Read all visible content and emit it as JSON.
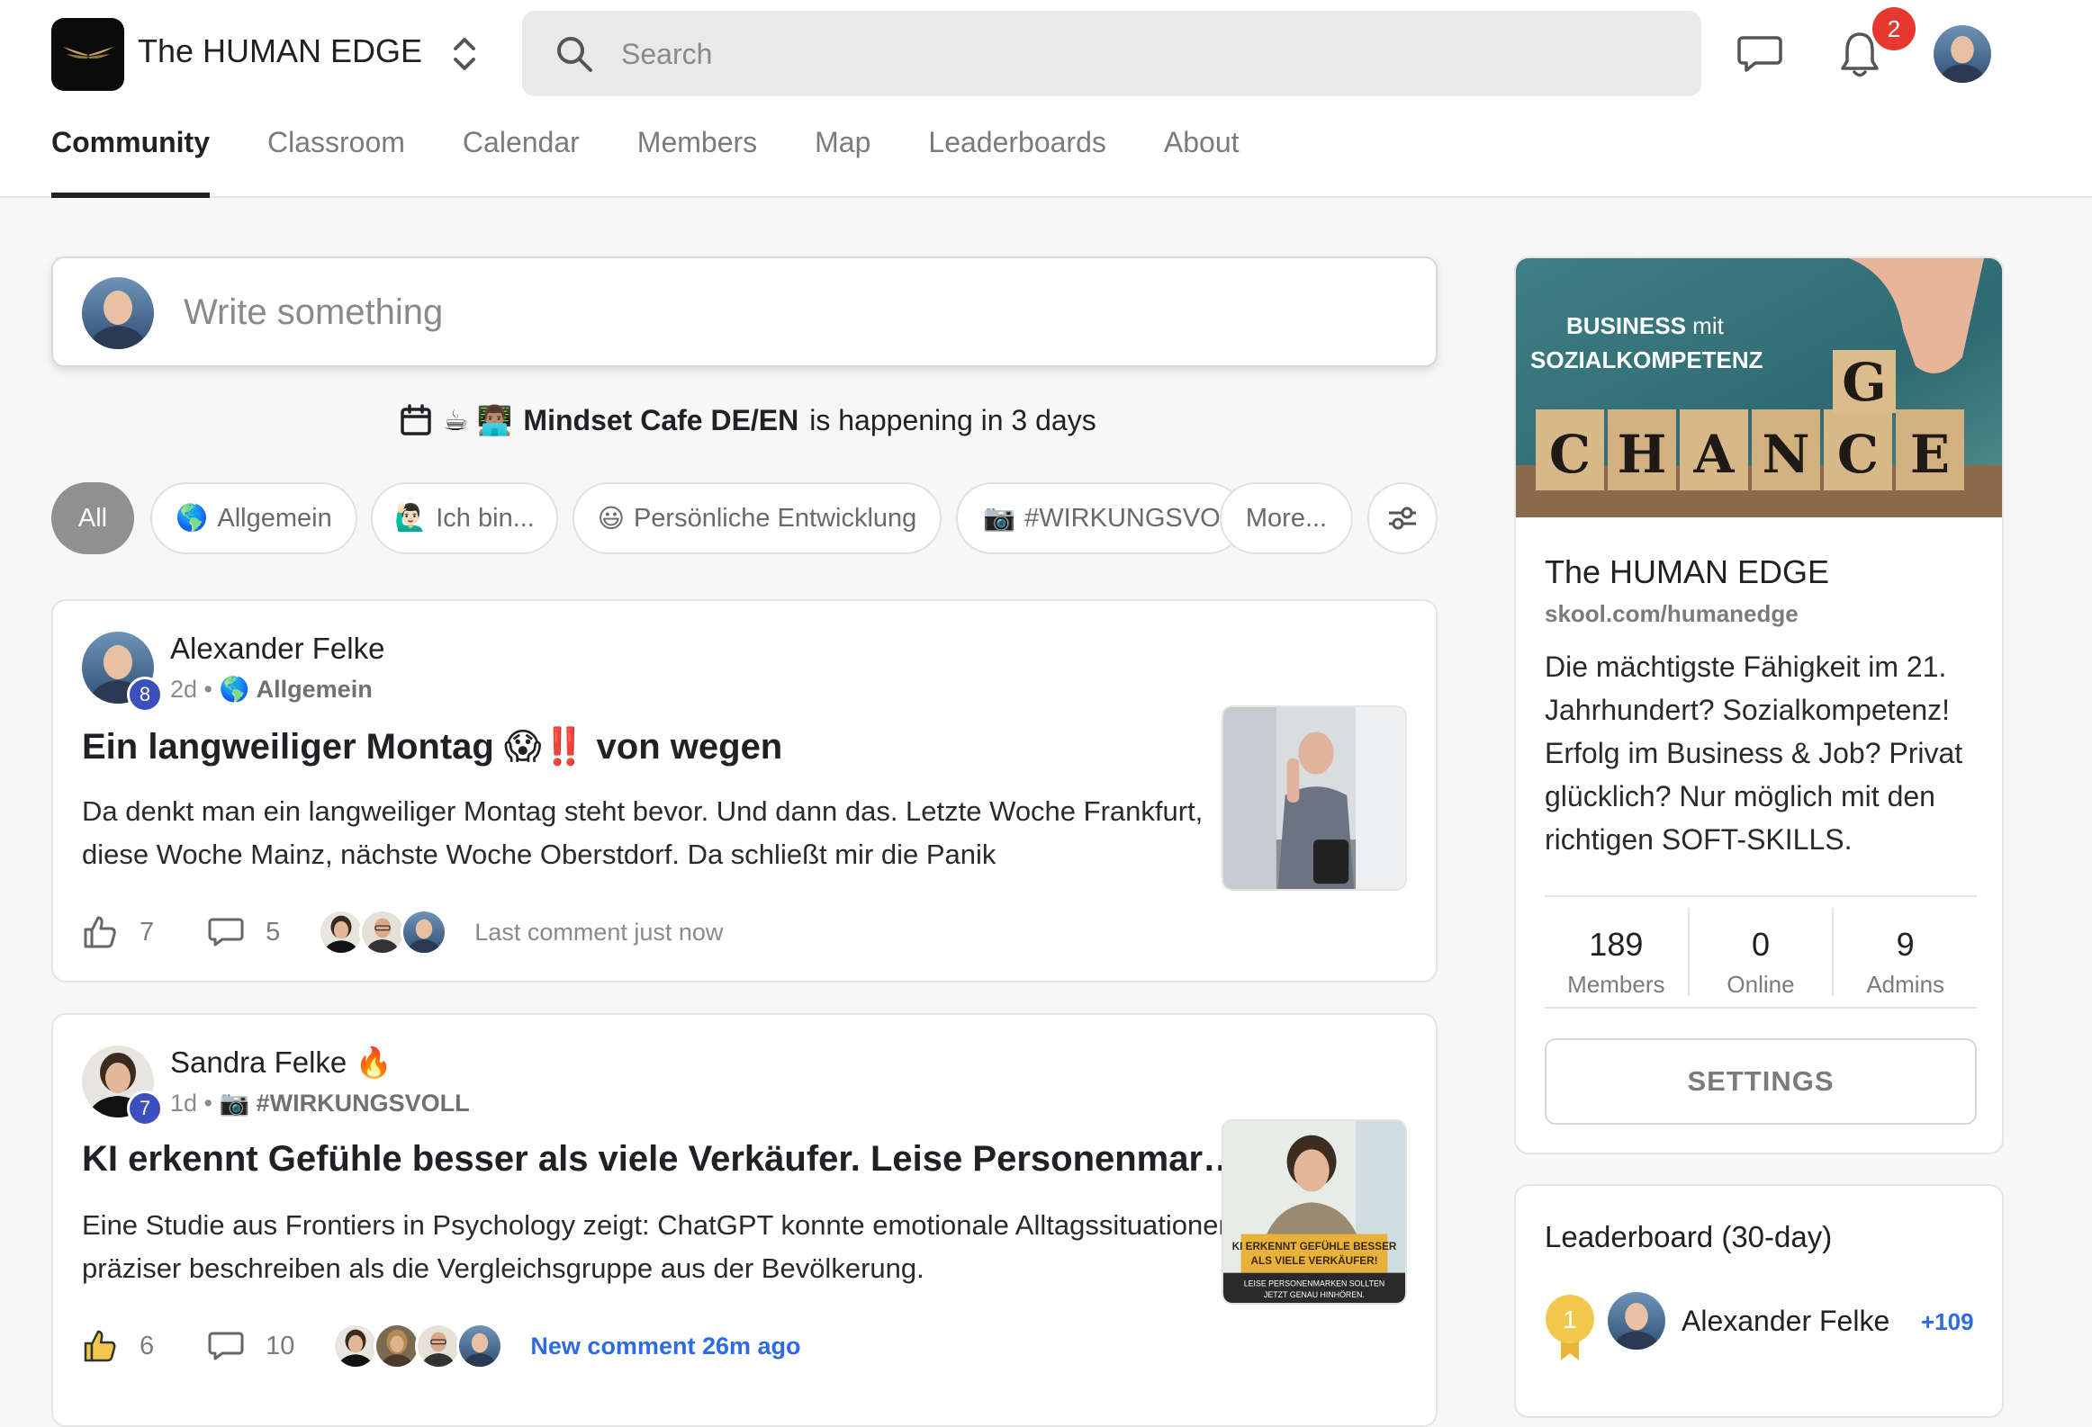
{
  "header": {
    "app_title": "The HUMAN EDGE",
    "search_placeholder": "Search",
    "notification_count": "2"
  },
  "tabs": [
    {
      "label": "Community",
      "active": true
    },
    {
      "label": "Classroom"
    },
    {
      "label": "Calendar"
    },
    {
      "label": "Members"
    },
    {
      "label": "Map"
    },
    {
      "label": "Leaderboards"
    },
    {
      "label": "About"
    }
  ],
  "composer": {
    "placeholder": "Write something"
  },
  "event": {
    "emoji": "☕ 👨🏽‍💻",
    "name": "Mindset Cafe DE/EN",
    "suffix": "is happening in 3 days"
  },
  "filters": [
    {
      "label": "All",
      "active": true
    },
    {
      "emoji": "🌎",
      "label": "Allgemein"
    },
    {
      "emoji": "🙋🏻‍♂️",
      "label": "Ich bin..."
    },
    {
      "emoji": "😃",
      "label": "Persönliche Entwicklung"
    },
    {
      "emoji": "📷",
      "label": "#WIRKUNGSVOLL"
    },
    {
      "label": "More..."
    }
  ],
  "posts": [
    {
      "author": "Alexander Felke",
      "author_emoji": "",
      "level": "8",
      "age": "2d",
      "category_emoji": "🌎",
      "category": "Allgemein",
      "title": "Ein langweiliger Montag 😱‼️ von wegen",
      "body": "Da denkt man ein langweiliger Montag steht bevor. Und dann das. Letzte Woche Frankfurt, diese Woche Mainz, nächste Woche Oberstdorf. Da schließt mir die Panik",
      "likes": "7",
      "comments": "5",
      "last_comment": "Last comment just now",
      "liked": false
    },
    {
      "author": "Sandra Felke",
      "author_emoji": "🔥",
      "level": "7",
      "age": "1d",
      "category_emoji": "📷",
      "category": "#WIRKUNGSVOLL",
      "title": "KI erkennt Gefühle besser als viele Verkäufer. Leise Personenmarken sollten jetzt genau hinhören",
      "body": "Eine Studie aus Frontiers in Psychology zeigt: ChatGPT konnte emotionale Alltagssituationen präziser beschreiben als die Vergleichsgruppe aus der Bevölkerung.",
      "likes": "6",
      "comments": "10",
      "last_comment": "New comment 26m ago",
      "liked": true,
      "thumb_text_1": "KI ERKENNT GEFÜHLE BESSER",
      "thumb_text_2": "ALS VIELE VERKÄUFER!",
      "thumb_text_3": "LEISE PERSONENMARKEN SOLLTEN",
      "thumb_text_4": "JETZT GENAU HINHÖREN."
    }
  ],
  "sidebar": {
    "cover_line1_bold": "BUSINESS",
    "cover_line1_rest": "mit",
    "cover_line2": "SOZIALKOMPETENZ",
    "cover_letters": [
      "C",
      "H",
      "A",
      "N",
      "C",
      "E"
    ],
    "cover_lifted": "G",
    "title": "The HUMAN EDGE",
    "url": "skool.com/humanedge",
    "description": "Die mächtigste Fähigkeit im 21. Jahrhundert? Sozialkompetenz! Erfolg im Business & Job? Privat glücklich? Nur möglich mit den richtigen SOFT-SKILLS.",
    "stats": [
      {
        "value": "189",
        "label": "Members"
      },
      {
        "value": "0",
        "label": "Online"
      },
      {
        "value": "9",
        "label": "Admins"
      }
    ],
    "settings_label": "SETTINGS"
  },
  "leaderboard": {
    "title": "Leaderboard (30-day)",
    "entries": [
      {
        "rank": "1",
        "name": "Alexander Felke",
        "points": "+109"
      }
    ]
  },
  "colors": {
    "accent_blue": "#2f6ae5",
    "badge_red": "#e5392f",
    "level_blue": "#3b4fbf",
    "medal_gold": "#f2c94c"
  }
}
